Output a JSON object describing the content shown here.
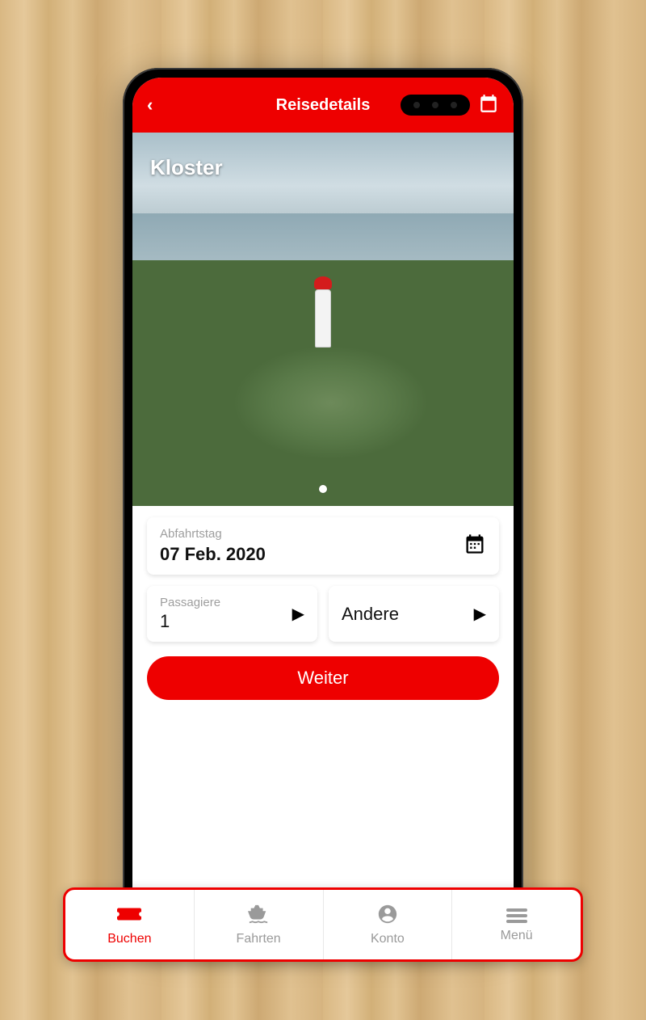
{
  "header": {
    "title": "Reisedetails"
  },
  "hero": {
    "location": "Kloster"
  },
  "form": {
    "date": {
      "label": "Abfahrtstag",
      "value": "07 Feb. 2020"
    },
    "passengers": {
      "label": "Passagiere",
      "value": "1"
    },
    "other": {
      "value": "Andere"
    },
    "cta": "Weiter"
  },
  "nav": {
    "buchen": "Buchen",
    "fahrten": "Fahrten",
    "konto": "Konto",
    "menu": "Menü"
  }
}
